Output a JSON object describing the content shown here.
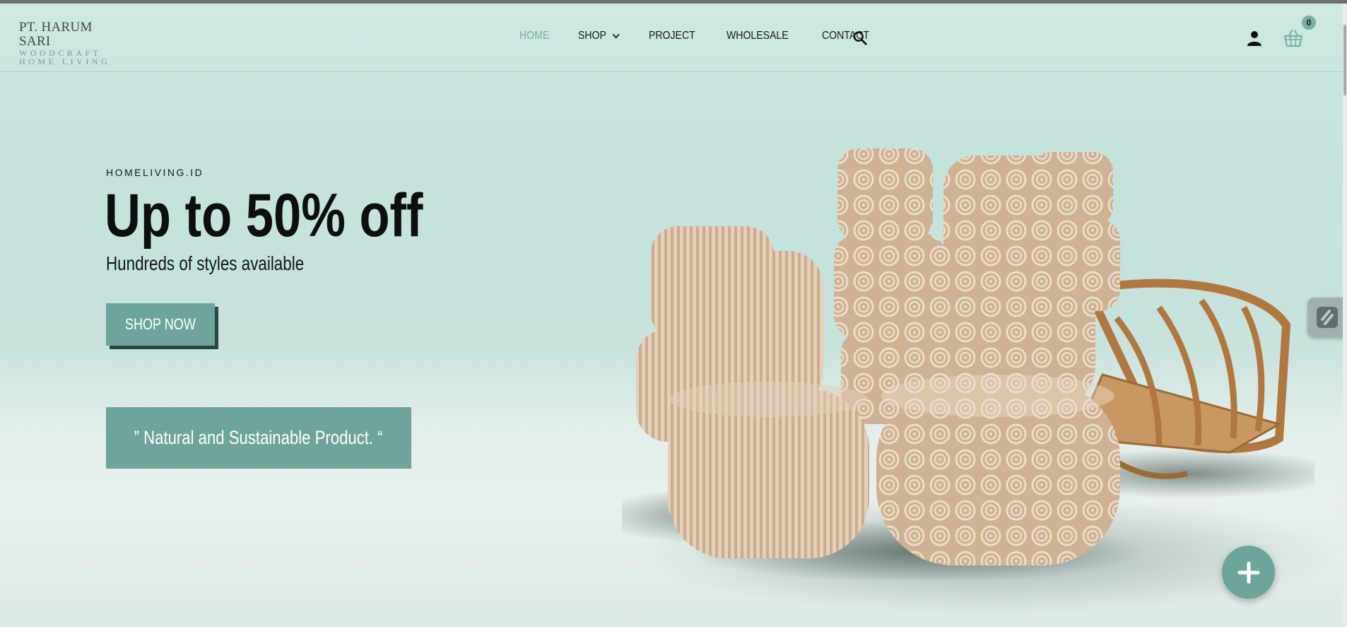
{
  "brand": {
    "line1": "PT. HARUM SARI",
    "line2": "WOODCRAFT",
    "line3": "HOME LIVING"
  },
  "nav": {
    "items": [
      {
        "label": "HOME",
        "active": true
      },
      {
        "label": "SHOP",
        "has_dropdown": true
      },
      {
        "label": "PROJECT"
      },
      {
        "label": "WHOLESALE"
      },
      {
        "label": "CONTACT"
      }
    ]
  },
  "cart": {
    "count": "0"
  },
  "hero": {
    "eyebrow": "HOMELIVING.ID",
    "headline": "Up to 50% off",
    "subline": "Hundreds of styles available",
    "cta_label": "SHOP NOW",
    "quote": "” Natural and Sustainable Product. “"
  },
  "icons": {
    "search": "search-icon",
    "user": "user-icon",
    "cart": "basket-icon",
    "fab": "plus-icon",
    "side_tab": "slider-revolution-icon"
  },
  "colors": {
    "accent": "#6ea59a",
    "active_nav": "#7aaea4",
    "background": "#c8e3dd",
    "rattan": "#d8bfa3"
  }
}
